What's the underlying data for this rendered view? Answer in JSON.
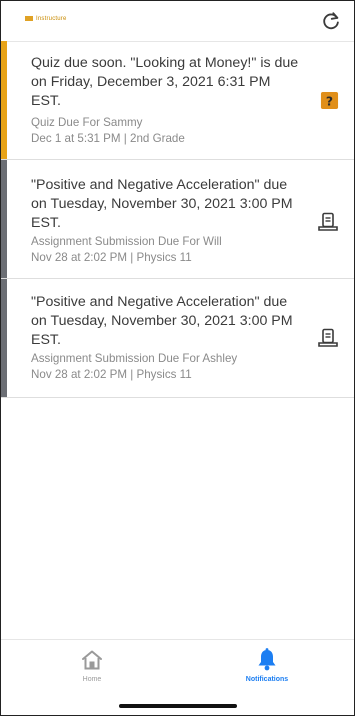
{
  "header": {
    "brand_label": "Instructure",
    "refresh_icon": "refresh-icon"
  },
  "notifications": [
    {
      "title": "Quiz due soon. \"Looking at Money!\" is due on Friday, December 3, 2021 6:31 PM EST.",
      "subtitle": "Quiz Due For Sammy",
      "meta": "Dec 1 at 5:31 PM | 2nd Grade",
      "icon": "quiz-question-icon",
      "accent": "#E8A317"
    },
    {
      "title": "\"Positive and Negative Acceleration\" due on Tuesday, November 30, 2021 3:00 PM EST.",
      "subtitle": "Assignment Submission Due For Will",
      "meta": "Nov 28 at 2:02 PM | Physics 11",
      "icon": "assignment-icon",
      "accent": "#6B6E74"
    },
    {
      "title": "\"Positive and Negative Acceleration\" due on Tuesday, November 30, 2021 3:00 PM EST.",
      "subtitle": "Assignment Submission Due For Ashley",
      "meta": "Nov 28 at 2:02 PM | Physics 11",
      "icon": "assignment-icon",
      "accent": "#6B6E74"
    }
  ],
  "tabs": [
    {
      "label": "Home",
      "icon": "home-icon",
      "active": false
    },
    {
      "label": "Notifications",
      "icon": "bell-icon",
      "active": true
    }
  ],
  "colors": {
    "active_tab": "#1C7EF2",
    "inactive_tab": "#9A9A9A",
    "quiz_icon_bg": "#E08F1A"
  }
}
